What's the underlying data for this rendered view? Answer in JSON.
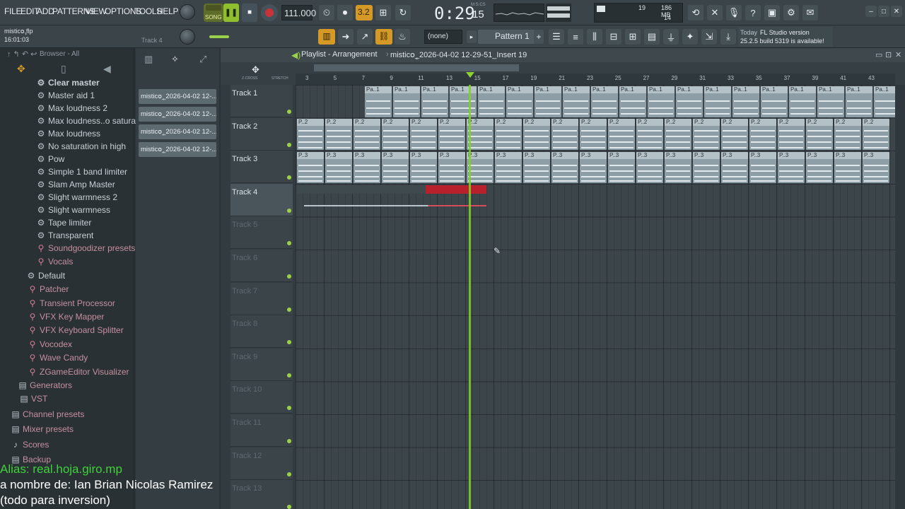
{
  "menu": [
    "FILE",
    "EDIT",
    "ADD",
    "PATTERNS",
    "VIEW",
    "OPTIONS",
    "TOOLS",
    "HELP"
  ],
  "transport": {
    "song_label": "SONG",
    "tempo": "111.000",
    "time_main": "0:29",
    "time_sub": "15",
    "time_units": "M:S:CS",
    "meter": "3.2",
    "cpu": "19",
    "mem": "186 MB",
    "poly": "14"
  },
  "project": {
    "file": "misticoٕ.flp",
    "time": "16:01:03",
    "track_hint": "Track 4"
  },
  "toolbar2": {
    "snap": "(none)",
    "pattern": "Pattern 1",
    "news_day": "Today",
    "news_title": "FL Studio version",
    "news_body": "25.2.5 build 5319 is available!"
  },
  "browser": {
    "title": "Browser - All",
    "items": [
      {
        "label": "Clear master",
        "kind": "gear"
      },
      {
        "label": "Master aid 1",
        "kind": "gear"
      },
      {
        "label": "Max loudness 2",
        "kind": "gear"
      },
      {
        "label": "Max loudness..o saturation",
        "kind": "gear"
      },
      {
        "label": "Max loudness",
        "kind": "gear"
      },
      {
        "label": "No saturation in high",
        "kind": "gear"
      },
      {
        "label": "Pow",
        "kind": "gear"
      },
      {
        "label": "Simple 1 band limiter",
        "kind": "gear"
      },
      {
        "label": "Slam Amp Master",
        "kind": "gear"
      },
      {
        "label": "Slight warmness 2",
        "kind": "gear"
      },
      {
        "label": "Slight warmness",
        "kind": "gear"
      },
      {
        "label": "Tape limiter",
        "kind": "gear"
      },
      {
        "label": "Transparent",
        "kind": "gear"
      },
      {
        "label": "Soundgoodizer presets",
        "kind": "plug"
      },
      {
        "label": "Vocals",
        "kind": "plug"
      },
      {
        "label": "Default",
        "kind": "gear"
      },
      {
        "label": "Patcher",
        "kind": "plug"
      },
      {
        "label": "Transient Processor",
        "kind": "plug"
      },
      {
        "label": "VFX Key Mapper",
        "kind": "plug"
      },
      {
        "label": "VFX Keyboard Splitter",
        "kind": "plug"
      },
      {
        "label": "Vocodex",
        "kind": "plug"
      },
      {
        "label": "Wave Candy",
        "kind": "plug"
      },
      {
        "label": "ZGameEditor Visualizer",
        "kind": "plug"
      },
      {
        "label": "Generators",
        "kind": "folder"
      },
      {
        "label": "VST",
        "kind": "folder"
      },
      {
        "label": "Channel presets",
        "kind": "folder"
      },
      {
        "label": "Mixer presets",
        "kind": "folder"
      },
      {
        "label": "Scores",
        "kind": "note"
      },
      {
        "label": "Backup",
        "kind": "folder"
      }
    ]
  },
  "patterns": [
    "misticoٕ_2026-04-02 12-...",
    "misticoٕ_2026-04-02 12-...",
    "misticoٕ_2026-04-02 12-...",
    "misticoٕ_2026-04-02 12-..."
  ],
  "playlist": {
    "title": "Playlist - Arrangement",
    "crumb": "misticoٕ_2026-04-02 12-29-51_Insert 19",
    "zcross": "Z-CROSS",
    "stretch": "STRETCH",
    "ruler": [
      "3",
      "5",
      "7",
      "9",
      "11",
      "13",
      "15",
      "17",
      "19",
      "21",
      "23",
      "25",
      "27",
      "29",
      "31",
      "33",
      "35",
      "37",
      "39",
      "41",
      "43"
    ],
    "tracks": [
      "Track 1",
      "Track 2",
      "Track 3",
      "Track 4",
      "Track 5",
      "Track 6",
      "Track 7",
      "Track 8",
      "Track 9",
      "Track 10",
      "Track 11",
      "Track 12",
      "Track 13"
    ],
    "clip_labels": {
      "t1": "Pa..1",
      "t2": "P..2",
      "t3": "P..3"
    }
  },
  "overlay": {
    "line1": "Alias: real.hoja.giro.mp",
    "line2": "a nombre de: Ian Brian Nicolas Ramirez",
    "line3": "(todo para inversion)"
  },
  "colors": {
    "accent_green": "#9bd14a",
    "playhead": "#7ed321",
    "record_red": "#c8333a",
    "clip_red": "#b8202c",
    "overlay_green": "#3fd13a"
  }
}
